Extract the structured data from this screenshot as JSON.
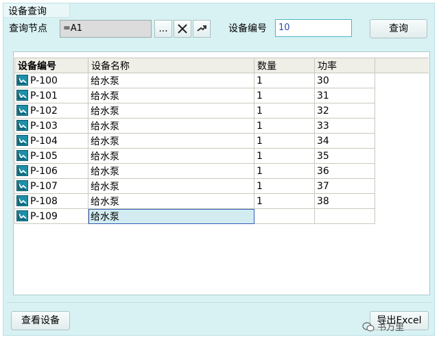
{
  "window": {
    "title": "设备查询"
  },
  "query": {
    "node_label": "查询节点",
    "node_value": "=A1",
    "browse_label": "...",
    "clear_label": "✕",
    "device_no_label": "设备编号",
    "device_no_value": "10",
    "search_label": "查询"
  },
  "table": {
    "columns": [
      "设备编号",
      "设备名称",
      "数量",
      "功率"
    ],
    "rows": [
      {
        "id": "P-100",
        "name": "给水泵",
        "qty": "1",
        "power": "30"
      },
      {
        "id": "P-101",
        "name": "给水泵",
        "qty": "1",
        "power": "31"
      },
      {
        "id": "P-102",
        "name": "给水泵",
        "qty": "1",
        "power": "32"
      },
      {
        "id": "P-103",
        "name": "给水泵",
        "qty": "1",
        "power": "33"
      },
      {
        "id": "P-104",
        "name": "给水泵",
        "qty": "1",
        "power": "34"
      },
      {
        "id": "P-105",
        "name": "给水泵",
        "qty": "1",
        "power": "35"
      },
      {
        "id": "P-106",
        "name": "给水泵",
        "qty": "1",
        "power": "36"
      },
      {
        "id": "P-107",
        "name": "给水泵",
        "qty": "1",
        "power": "37"
      },
      {
        "id": "P-108",
        "name": "给水泵",
        "qty": "1",
        "power": "38"
      },
      {
        "id": "P-109",
        "name": "给水泵",
        "qty": "",
        "power": ""
      }
    ],
    "row_icon": "device-icon"
  },
  "footer": {
    "view_label": "查看设备",
    "export_label": "导出Excel"
  },
  "watermark": "书万里",
  "colors": {
    "panel_bg": "#d8f1f3",
    "accent": "#4bb6c6",
    "selection": "#d2ecf1"
  }
}
